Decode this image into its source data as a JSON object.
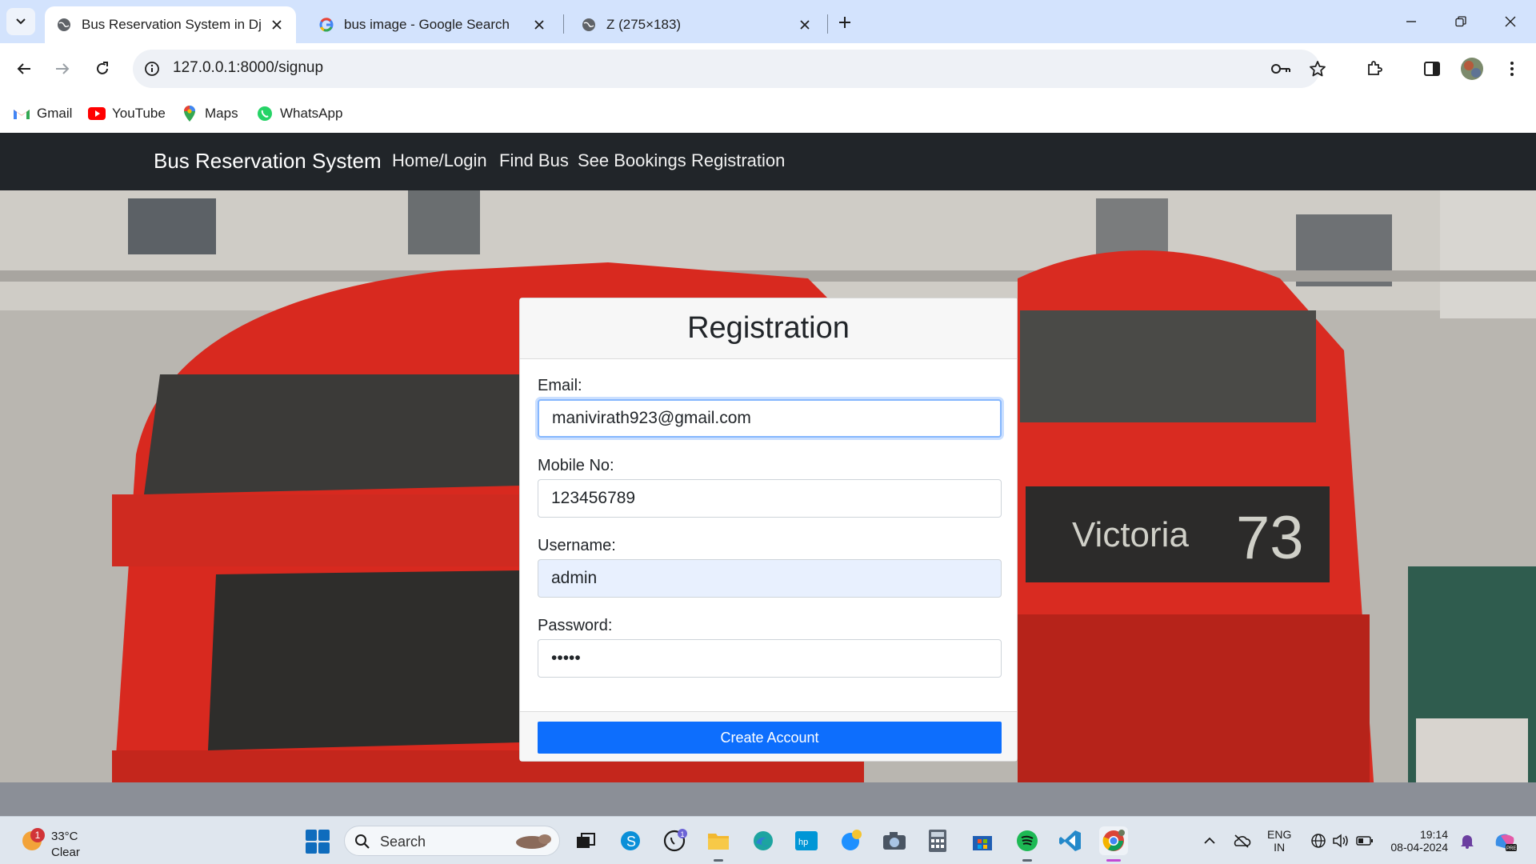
{
  "browser": {
    "tabs": [
      {
        "title": "Bus Reservation System in Djan",
        "active": true
      },
      {
        "title": "bus image - Google Search",
        "active": false
      },
      {
        "title": "Z (275×183)",
        "active": false
      }
    ],
    "url": "127.0.0.1:8000/signup",
    "bookmarks": [
      "Gmail",
      "YouTube",
      "Maps",
      "WhatsApp"
    ]
  },
  "navbar": {
    "brand": "Bus Reservation System",
    "links": [
      "Home/Login",
      "Find Bus",
      "See Bookings",
      "Registration"
    ]
  },
  "form": {
    "title": "Registration",
    "fields": [
      {
        "label": "Email:",
        "value": "manivirath923@gmail.com"
      },
      {
        "label": "Mobile No:",
        "value": "123456789"
      },
      {
        "label": "Username:",
        "value": "admin"
      },
      {
        "label": "Password:",
        "value": "•••••"
      }
    ],
    "submit_label": "Create Account"
  },
  "hero_sign": {
    "destination": "Victoria",
    "route": "73"
  },
  "taskbar": {
    "weather_temp": "33°C",
    "weather_cond": "Clear",
    "weather_badge": "1",
    "search_label": "Search",
    "whatsapp_badge": "1",
    "lang_top": "ENG",
    "lang_bottom": "IN",
    "time": "19:14",
    "date": "08-04-2024"
  },
  "colors": {
    "navbar_bg": "#212529",
    "primary": "#0d6efd",
    "tabstrip": "#d3e3fd",
    "bus_red": "#d8291f"
  }
}
